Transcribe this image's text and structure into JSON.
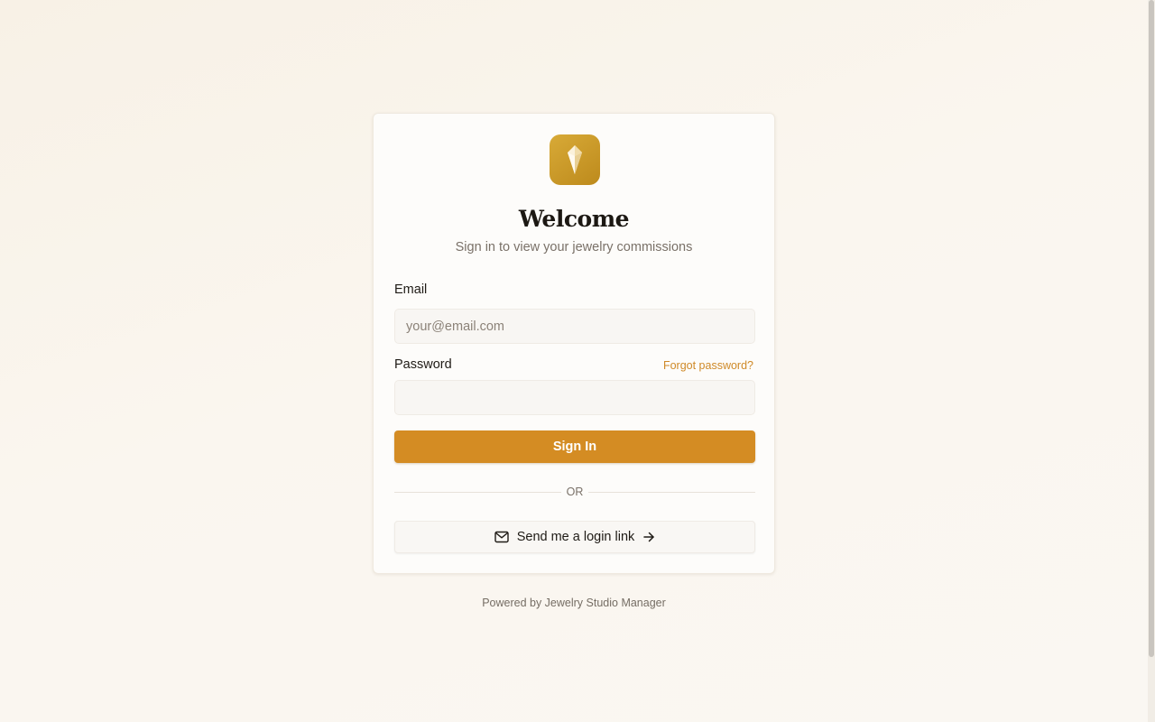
{
  "login": {
    "title": "Welcome",
    "subtitle": "Sign in to view your jewelry commissions",
    "logo_icon": "gem-icon",
    "email_label": "Email",
    "email_placeholder": "your@email.com",
    "email_value": "",
    "password_label": "Password",
    "password_value": "",
    "forgot_password": "Forgot password?",
    "sign_in_label": "Sign In",
    "divider_text": "OR",
    "login_link_label": "Send me a login link",
    "login_link_icons": [
      "mail-icon",
      "arrow-right-icon"
    ]
  },
  "footer": {
    "text": "Powered by Jewelry Studio Manager"
  },
  "colors": {
    "accent": "#d48c23",
    "link": "#cf8a28",
    "logo_gradient_start": "#d8aa37",
    "logo_gradient_end": "#bd8a1c",
    "background": "#faf6ef"
  }
}
